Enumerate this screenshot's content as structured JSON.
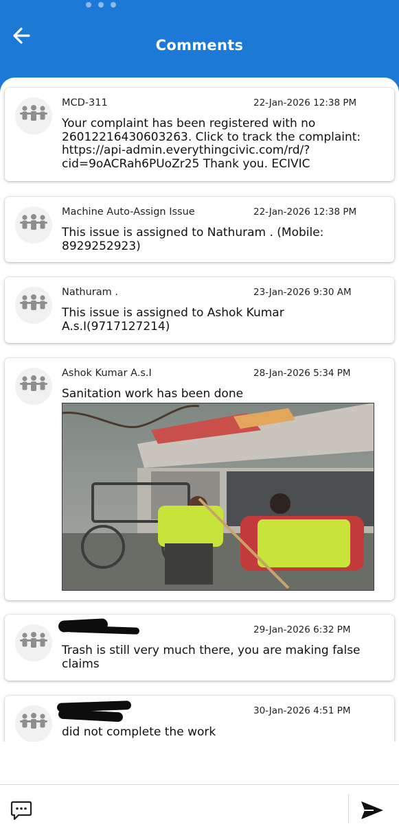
{
  "header": {
    "title": "Comments",
    "back_icon": "arrow-left-icon",
    "bg": "#1c7ad6"
  },
  "comments": [
    {
      "author": "MCD-311",
      "time": "22-Jan-2026 12:38 PM",
      "message": "Your complaint has been registered with no 26012216430603263. Click to track the complaint: https://api-admin.everythingcivic.com/rd/?cid=9oACRah6PUoZr25 Thank you. ECIVIC"
    },
    {
      "author": "Machine Auto-Assign Issue",
      "time": "22-Jan-2026 12:38 PM",
      "message": "This issue is assigned to Nathuram . (Mobile: 8929252923)"
    },
    {
      "author": "Nathuram .",
      "time": "23-Jan-2026 9:30 AM",
      "message": "This issue is assigned to Ashok Kumar A.s.I(9717127214)"
    },
    {
      "author": "Ashok Kumar A.s.I",
      "time": "28-Jan-2026 5:34 PM",
      "message": "Sanitation work has been done",
      "has_photo": true
    },
    {
      "author": "",
      "time": "29-Jan-2026 6:32 PM",
      "message": "Trash is still very much there, you are making false claims"
    },
    {
      "author": "",
      "time": "30-Jan-2026 4:51 PM",
      "message": "did not complete the work"
    }
  ],
  "footer": {
    "chat_icon": "chat-bubble-icon",
    "send_icon": "send-icon"
  }
}
